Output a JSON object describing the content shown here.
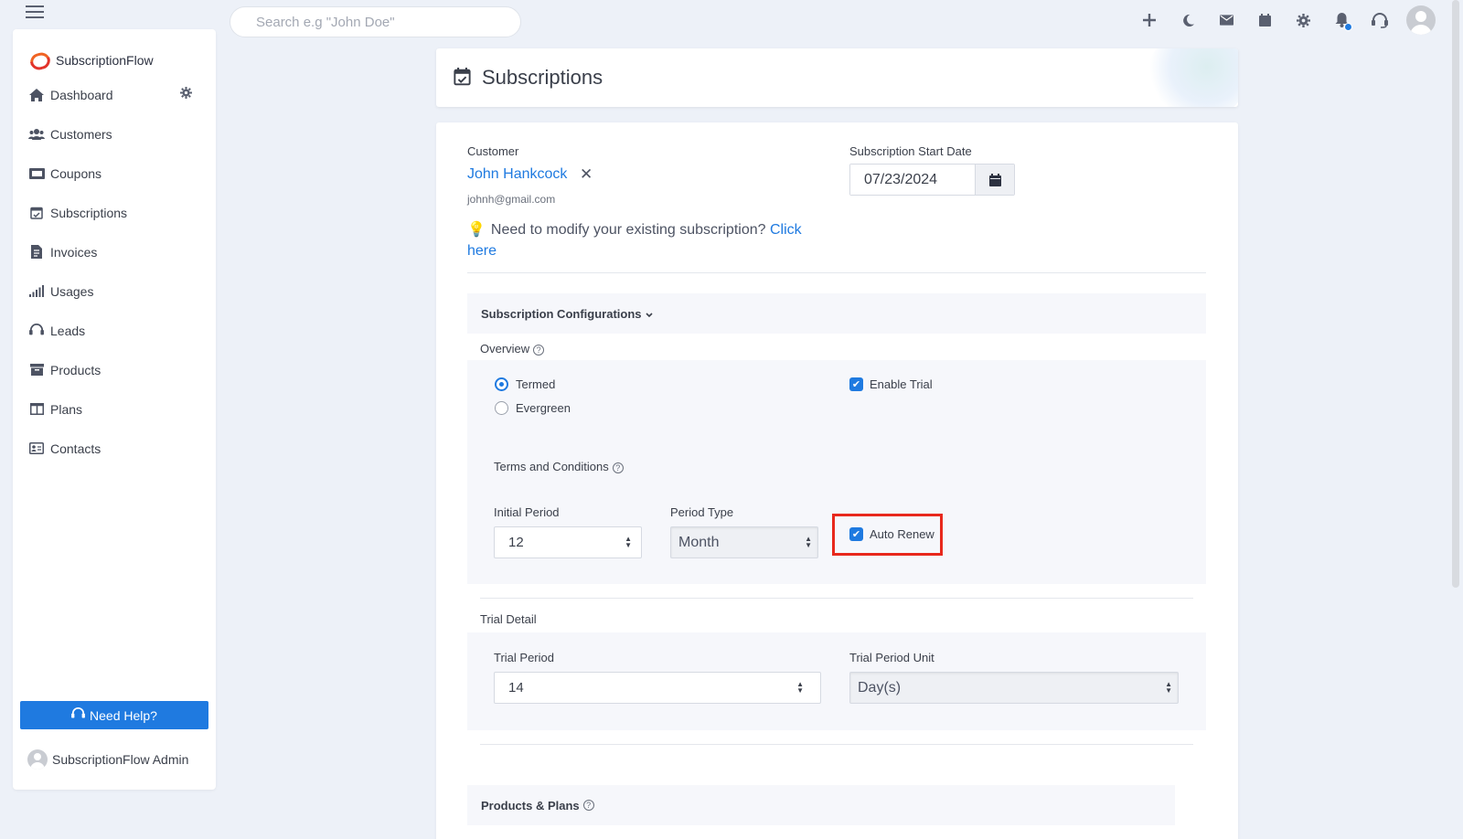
{
  "topbar": {
    "search_placeholder": "Search e.g \"John Doe\"",
    "icons": [
      "plus-icon",
      "moon-icon",
      "mail-icon",
      "calendar-icon",
      "gear-icon",
      "bell-icon",
      "headset-icon",
      "user-avatar"
    ],
    "notification_dot_color": "#1f7ae0"
  },
  "sidebar": {
    "brand": "SubscriptionFlow",
    "items": [
      {
        "label": "Dashboard",
        "icon": "home-icon"
      },
      {
        "label": "Customers",
        "icon": "users-icon"
      },
      {
        "label": "Coupons",
        "icon": "ticket-icon"
      },
      {
        "label": "Subscriptions",
        "icon": "calendar-check-icon"
      },
      {
        "label": "Invoices",
        "icon": "invoice-icon"
      },
      {
        "label": "Usages",
        "icon": "bars-icon"
      },
      {
        "label": "Leads",
        "icon": "headset-icon"
      },
      {
        "label": "Products",
        "icon": "archive-icon"
      },
      {
        "label": "Plans",
        "icon": "columns-icon"
      },
      {
        "label": "Contacts",
        "icon": "contact-card-icon"
      }
    ],
    "help_label": "Need Help?",
    "admin_name": "SubscriptionFlow Admin"
  },
  "page": {
    "title": "Subscriptions"
  },
  "form": {
    "customer_label": "Customer",
    "customer_name": "John Hankcock",
    "customer_email": "johnh@gmail.com",
    "modify_text": "Need to modify your existing subscription?",
    "modify_link": "Click here",
    "start_date_label": "Subscription Start Date",
    "start_date_value": "07/23/2024",
    "config_title": "Subscription Configurations",
    "overview_label": "Overview",
    "term_options": [
      {
        "label": "Termed",
        "selected": true
      },
      {
        "label": "Evergreen",
        "selected": false
      }
    ],
    "enable_trial_label": "Enable Trial",
    "enable_trial_checked": true,
    "terms_label": "Terms and Conditions",
    "initial_period_label": "Initial Period",
    "initial_period_value": "12",
    "period_type_label": "Period Type",
    "period_type_value": "Month",
    "auto_renew_label": "Auto Renew",
    "auto_renew_checked": true,
    "trial_detail_label": "Trial Detail",
    "trial_period_label": "Trial Period",
    "trial_period_value": "14",
    "trial_unit_label": "Trial Period Unit",
    "trial_unit_value": "Day(s)",
    "products_plans_label": "Products & Plans"
  },
  "colors": {
    "accent": "#1f7ae0",
    "highlight": "#e8281c",
    "background": "#edf1f8"
  }
}
